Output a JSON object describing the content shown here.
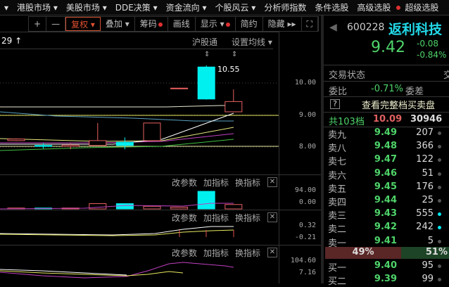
{
  "menu": [
    {
      "label": "▾"
    },
    {
      "label": "港股市场 ▾"
    },
    {
      "label": "美股市场 ▾"
    },
    {
      "label": "DDE决策 ▾"
    },
    {
      "label": "资金流向 ▾"
    },
    {
      "label": "个股风云 ▾"
    },
    {
      "label": "分析师指数"
    },
    {
      "label": "条件选股"
    },
    {
      "label": "高级选股",
      "dot": true
    },
    {
      "label": "超级选股"
    }
  ],
  "toolbar": [
    {
      "label": "+"
    },
    {
      "label": "—"
    },
    {
      "label": "复权 ▾",
      "active": true
    },
    {
      "label": "叠加 ▾"
    },
    {
      "label": "筹码",
      "dot": true
    },
    {
      "label": "画线"
    },
    {
      "label": "显示 ▾",
      "dot": true
    },
    {
      "label": "简约"
    },
    {
      "label": "隐藏 ▸▸"
    },
    {
      "label": "⛶"
    }
  ],
  "chart": {
    "period_label": "29 ↑",
    "hgt_label": "沪股通",
    "ma_label": "设置均线 ▾",
    "high_label": "10.55",
    "price_ticks": [
      "10.00",
      "9.00",
      "8.00"
    ],
    "candles": [
      [
        8.2,
        8.25,
        8.27,
        8.18
      ],
      [
        8.05,
        8.02,
        8.12,
        7.95
      ],
      [
        8.02,
        8.06,
        8.12,
        7.93
      ],
      [
        8.05,
        8.2,
        8.75,
        8.05
      ],
      [
        8.15,
        8.05,
        8.3,
        7.93
      ],
      [
        8.2,
        8.75,
        8.75,
        8.2
      ],
      [
        9.83,
        9.84,
        9.84,
        9.83
      ],
      [
        10.5,
        9.5,
        10.55,
        9.48
      ],
      [
        9.1,
        9.42,
        9.8,
        9.1
      ]
    ],
    "ind_buttons": [
      "改参数",
      "加指标",
      "换指标"
    ],
    "vol_ticks": [
      "94.00",
      "0.00"
    ],
    "macd_ticks": [
      "0.32",
      "-0.21"
    ],
    "kdj_ticks": [
      "104.60",
      "7.16"
    ]
  },
  "quote": {
    "code": "600228",
    "name": "返利科技",
    "price": "9.42",
    "change": "-0.08",
    "change_pct": "-0.84%",
    "status_label": "交易状态",
    "status_value": "交",
    "wb_label": "委比",
    "wb_value": "-0.71%",
    "wc_label": "委差",
    "help": "?",
    "full_book": "查看完整档买卖盘",
    "total_label": "共103档",
    "total_price": "10.09",
    "total_vol": "30946",
    "asks": [
      {
        "n": "卖九",
        "p": "9.49",
        "v": "207"
      },
      {
        "n": "卖八",
        "p": "9.48",
        "v": "366"
      },
      {
        "n": "卖七",
        "p": "9.47",
        "v": "122"
      },
      {
        "n": "卖六",
        "p": "9.46",
        "v": "51"
      },
      {
        "n": "卖五",
        "p": "9.45",
        "v": "176"
      },
      {
        "n": "卖四",
        "p": "9.44",
        "v": "25"
      },
      {
        "n": "卖三",
        "p": "9.43",
        "v": "555",
        "c": true
      },
      {
        "n": "卖二",
        "p": "9.42",
        "v": "242",
        "c": true
      },
      {
        "n": "卖一",
        "p": "9.41",
        "v": "5"
      }
    ],
    "sell_pct": "49%",
    "buy_pct": "51%",
    "bids": [
      {
        "n": "买一",
        "p": "9.40",
        "v": "95"
      },
      {
        "n": "买二",
        "p": "9.39",
        "v": "99"
      }
    ]
  },
  "colors": {
    "up": "#e86060",
    "down": "#00f0f0",
    "green": "#4fd36a"
  }
}
